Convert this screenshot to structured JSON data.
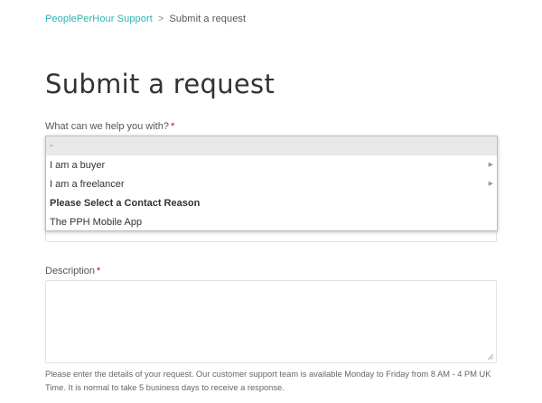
{
  "breadcrumb": {
    "home": "PeoplePerHour Support",
    "separator": ">",
    "current": "Submit a request"
  },
  "page": {
    "title": "Submit a request"
  },
  "form": {
    "topic": {
      "label": "What can we help you with?",
      "required_mark": "*",
      "options": [
        {
          "label": "-",
          "selected": true
        },
        {
          "label": "I am a buyer",
          "submenu": true
        },
        {
          "label": "I am a freelancer",
          "submenu": true
        },
        {
          "label": "Please Select a Contact Reason",
          "bold": true
        },
        {
          "label": "The PPH Mobile App"
        }
      ],
      "submenu_icon": "triangle-right"
    },
    "description": {
      "label": "Description",
      "required_mark": "*",
      "value": "",
      "help": "Please enter the details of your request. Our customer support team is available Monday to Friday from 8 AM - 4 PM UK Time. It is normal to take 5 business days to receive a response."
    }
  },
  "colors": {
    "link": "#2bb3b1",
    "required": "#d0021b",
    "selected_option_bg": "#e8e8e8"
  }
}
